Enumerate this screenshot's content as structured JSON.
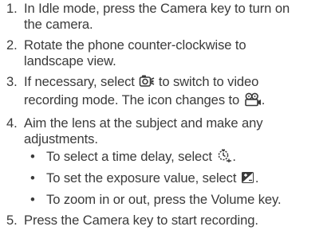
{
  "steps": [
    {
      "num": "1.",
      "lines": [
        "In Idle mode, press the Camera key to turn on",
        "the camera."
      ]
    },
    {
      "num": "2.",
      "lines": [
        "Rotate the phone counter-clockwise to",
        "landscape view."
      ]
    },
    {
      "num": "3.",
      "line1_before": "If necessary, select",
      "line1_after": "to switch to video",
      "line2_before": "recording mode. The icon changes to",
      "line2_after": ".",
      "icon1": "camera-switch-icon",
      "icon2": "video-camera-icon"
    },
    {
      "num": "4.",
      "lines": [
        "Aim the lens at the subject and make any",
        "adjustments."
      ],
      "subs": [
        {
          "bullet": "•",
          "text": "To select a time delay, select",
          "suffix": ".",
          "icon": "timer-icon"
        },
        {
          "bullet": "•",
          "text": "To set the exposure value, select",
          "suffix": ".",
          "icon": "exposure-icon"
        },
        {
          "bullet": "•",
          "text": "To zoom in or out, press the Volume key.",
          "suffix": ""
        }
      ]
    },
    {
      "num": "5.",
      "lines": [
        "Press the Camera key to start recording."
      ]
    }
  ]
}
